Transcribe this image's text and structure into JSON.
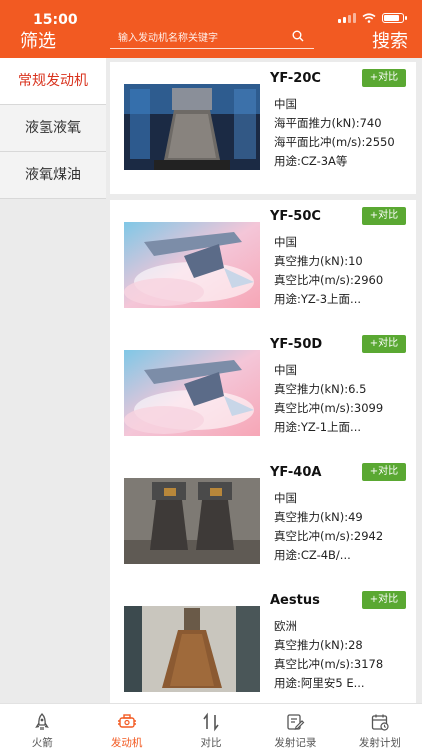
{
  "status_bar": {
    "time": "15:00"
  },
  "header": {
    "filter_label": "筛选",
    "search_placeholder": "输入发动机名称关键字",
    "search_label": "搜索"
  },
  "sidebar": {
    "items": [
      {
        "label": "常规发动机",
        "active": true
      },
      {
        "label": "液氢液氧",
        "active": false
      },
      {
        "label": "液氧煤油",
        "active": false
      }
    ]
  },
  "compare_label": "+对比",
  "engines": [
    {
      "name": "YF-20C",
      "region": "中国",
      "thrust": "海平面推力(kN):740",
      "isp": "海平面比冲(m/s):2550",
      "usage": "用途:CZ-3A等",
      "image": "engine-photo-icon"
    },
    {
      "name": "YF-50C",
      "region": "中国",
      "thrust": "真空推力(kN):10",
      "isp": "真空比冲(m/s):2960",
      "usage": "用途:YZ-3上面...",
      "image": "engine-illustration-icon"
    },
    {
      "name": "YF-50D",
      "region": "中国",
      "thrust": "真空推力(kN):6.5",
      "isp": "真空比冲(m/s):3099",
      "usage": "用途:YZ-1上面...",
      "image": "engine-illustration-icon"
    },
    {
      "name": "YF-40A",
      "region": "中国",
      "thrust": "真空推力(kN):49",
      "isp": "真空比冲(m/s):2942",
      "usage": "用途:CZ-4B/...",
      "image": "twin-engine-photo-icon"
    },
    {
      "name": "Aestus",
      "region": "欧洲",
      "thrust": "真空推力(kN):28",
      "isp": "真空比冲(m/s):3178",
      "usage": "用途:阿里安5 E...",
      "image": "engine-photo-icon"
    }
  ],
  "tabbar": {
    "tabs": [
      {
        "label": "火箭",
        "icon": "rocket-icon",
        "active": false
      },
      {
        "label": "发动机",
        "icon": "engine-icon",
        "active": true
      },
      {
        "label": "对比",
        "icon": "compare-icon",
        "active": false
      },
      {
        "label": "发射记录",
        "icon": "launch-record-icon",
        "active": false
      },
      {
        "label": "发射计划",
        "icon": "launch-plan-icon",
        "active": false
      }
    ]
  },
  "colors": {
    "accent": "#f25a22",
    "compare_button": "#5aa832",
    "sidebar_active_text": "#d9331e"
  }
}
